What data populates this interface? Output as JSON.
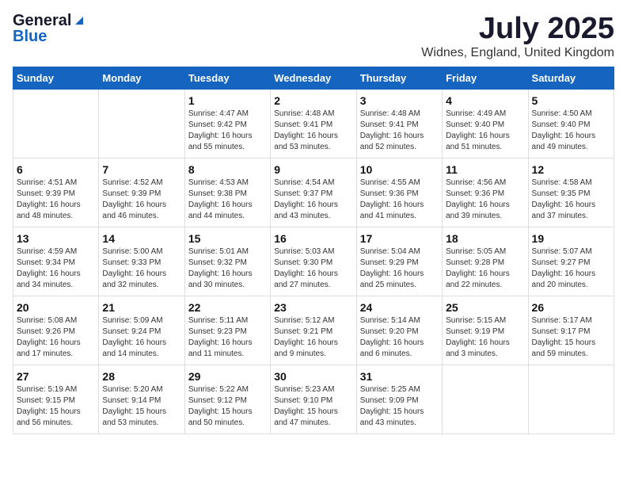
{
  "header": {
    "logo_general": "General",
    "logo_blue": "Blue",
    "month_title": "July 2025",
    "location": "Widnes, England, United Kingdom"
  },
  "days_of_week": [
    "Sunday",
    "Monday",
    "Tuesday",
    "Wednesday",
    "Thursday",
    "Friday",
    "Saturday"
  ],
  "weeks": [
    [
      {
        "day": "",
        "detail": ""
      },
      {
        "day": "",
        "detail": ""
      },
      {
        "day": "1",
        "detail": "Sunrise: 4:47 AM\nSunset: 9:42 PM\nDaylight: 16 hours\nand 55 minutes."
      },
      {
        "day": "2",
        "detail": "Sunrise: 4:48 AM\nSunset: 9:41 PM\nDaylight: 16 hours\nand 53 minutes."
      },
      {
        "day": "3",
        "detail": "Sunrise: 4:48 AM\nSunset: 9:41 PM\nDaylight: 16 hours\nand 52 minutes."
      },
      {
        "day": "4",
        "detail": "Sunrise: 4:49 AM\nSunset: 9:40 PM\nDaylight: 16 hours\nand 51 minutes."
      },
      {
        "day": "5",
        "detail": "Sunrise: 4:50 AM\nSunset: 9:40 PM\nDaylight: 16 hours\nand 49 minutes."
      }
    ],
    [
      {
        "day": "6",
        "detail": "Sunrise: 4:51 AM\nSunset: 9:39 PM\nDaylight: 16 hours\nand 48 minutes."
      },
      {
        "day": "7",
        "detail": "Sunrise: 4:52 AM\nSunset: 9:39 PM\nDaylight: 16 hours\nand 46 minutes."
      },
      {
        "day": "8",
        "detail": "Sunrise: 4:53 AM\nSunset: 9:38 PM\nDaylight: 16 hours\nand 44 minutes."
      },
      {
        "day": "9",
        "detail": "Sunrise: 4:54 AM\nSunset: 9:37 PM\nDaylight: 16 hours\nand 43 minutes."
      },
      {
        "day": "10",
        "detail": "Sunrise: 4:55 AM\nSunset: 9:36 PM\nDaylight: 16 hours\nand 41 minutes."
      },
      {
        "day": "11",
        "detail": "Sunrise: 4:56 AM\nSunset: 9:36 PM\nDaylight: 16 hours\nand 39 minutes."
      },
      {
        "day": "12",
        "detail": "Sunrise: 4:58 AM\nSunset: 9:35 PM\nDaylight: 16 hours\nand 37 minutes."
      }
    ],
    [
      {
        "day": "13",
        "detail": "Sunrise: 4:59 AM\nSunset: 9:34 PM\nDaylight: 16 hours\nand 34 minutes."
      },
      {
        "day": "14",
        "detail": "Sunrise: 5:00 AM\nSunset: 9:33 PM\nDaylight: 16 hours\nand 32 minutes."
      },
      {
        "day": "15",
        "detail": "Sunrise: 5:01 AM\nSunset: 9:32 PM\nDaylight: 16 hours\nand 30 minutes."
      },
      {
        "day": "16",
        "detail": "Sunrise: 5:03 AM\nSunset: 9:30 PM\nDaylight: 16 hours\nand 27 minutes."
      },
      {
        "day": "17",
        "detail": "Sunrise: 5:04 AM\nSunset: 9:29 PM\nDaylight: 16 hours\nand 25 minutes."
      },
      {
        "day": "18",
        "detail": "Sunrise: 5:05 AM\nSunset: 9:28 PM\nDaylight: 16 hours\nand 22 minutes."
      },
      {
        "day": "19",
        "detail": "Sunrise: 5:07 AM\nSunset: 9:27 PM\nDaylight: 16 hours\nand 20 minutes."
      }
    ],
    [
      {
        "day": "20",
        "detail": "Sunrise: 5:08 AM\nSunset: 9:26 PM\nDaylight: 16 hours\nand 17 minutes."
      },
      {
        "day": "21",
        "detail": "Sunrise: 5:09 AM\nSunset: 9:24 PM\nDaylight: 16 hours\nand 14 minutes."
      },
      {
        "day": "22",
        "detail": "Sunrise: 5:11 AM\nSunset: 9:23 PM\nDaylight: 16 hours\nand 11 minutes."
      },
      {
        "day": "23",
        "detail": "Sunrise: 5:12 AM\nSunset: 9:21 PM\nDaylight: 16 hours\nand 9 minutes."
      },
      {
        "day": "24",
        "detail": "Sunrise: 5:14 AM\nSunset: 9:20 PM\nDaylight: 16 hours\nand 6 minutes."
      },
      {
        "day": "25",
        "detail": "Sunrise: 5:15 AM\nSunset: 9:19 PM\nDaylight: 16 hours\nand 3 minutes."
      },
      {
        "day": "26",
        "detail": "Sunrise: 5:17 AM\nSunset: 9:17 PM\nDaylight: 15 hours\nand 59 minutes."
      }
    ],
    [
      {
        "day": "27",
        "detail": "Sunrise: 5:19 AM\nSunset: 9:15 PM\nDaylight: 15 hours\nand 56 minutes."
      },
      {
        "day": "28",
        "detail": "Sunrise: 5:20 AM\nSunset: 9:14 PM\nDaylight: 15 hours\nand 53 minutes."
      },
      {
        "day": "29",
        "detail": "Sunrise: 5:22 AM\nSunset: 9:12 PM\nDaylight: 15 hours\nand 50 minutes."
      },
      {
        "day": "30",
        "detail": "Sunrise: 5:23 AM\nSunset: 9:10 PM\nDaylight: 15 hours\nand 47 minutes."
      },
      {
        "day": "31",
        "detail": "Sunrise: 5:25 AM\nSunset: 9:09 PM\nDaylight: 15 hours\nand 43 minutes."
      },
      {
        "day": "",
        "detail": ""
      },
      {
        "day": "",
        "detail": ""
      }
    ]
  ]
}
